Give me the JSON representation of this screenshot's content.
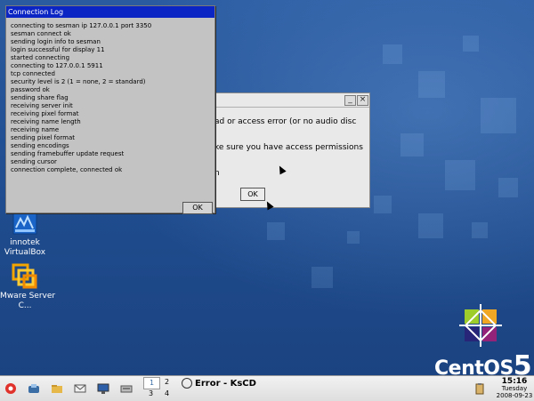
{
  "desktop": {
    "icons": [
      {
        "name": "virtualbox-icon",
        "label": "innotek VirtualBox"
      },
      {
        "name": "vmware-icon",
        "label": "VMware Server C..."
      }
    ],
    "logo": {
      "word": "CentOS",
      "version": "5"
    }
  },
  "error_dialog": {
    "minimize_symbol": "_",
    "close_symbol": "×",
    "lines": [
      "ad or access error (or no audio disc",
      "ke sure you have access permissions",
      "n"
    ],
    "ok_label": "OK"
  },
  "connection_log": {
    "title": "Connection Log",
    "lines": [
      "connecting to sesman ip 127.0.0.1 port 3350",
      "sesman connect ok",
      "sending login info to sesman",
      "login successful for display 11",
      "started connecting",
      "connecting to 127.0.0.1 5911",
      "tcp connected",
      "security level is 2 (1 = none, 2 = standard)",
      "password ok",
      "sending share flag",
      "receiving server init",
      "receiving pixel format",
      "receiving name length",
      "receiving name",
      "sending pixel format",
      "sending encodings",
      "sending framebuffer update request",
      "sending cursor",
      "connection complete, connected ok"
    ],
    "ok_label": "OK"
  },
  "taskbar": {
    "pager": [
      "1",
      "2",
      "3",
      "4"
    ],
    "active_task": "Error - KsCD",
    "clock": {
      "time": "15:16",
      "day": "Tuesday",
      "date": "2008-09-23"
    }
  }
}
